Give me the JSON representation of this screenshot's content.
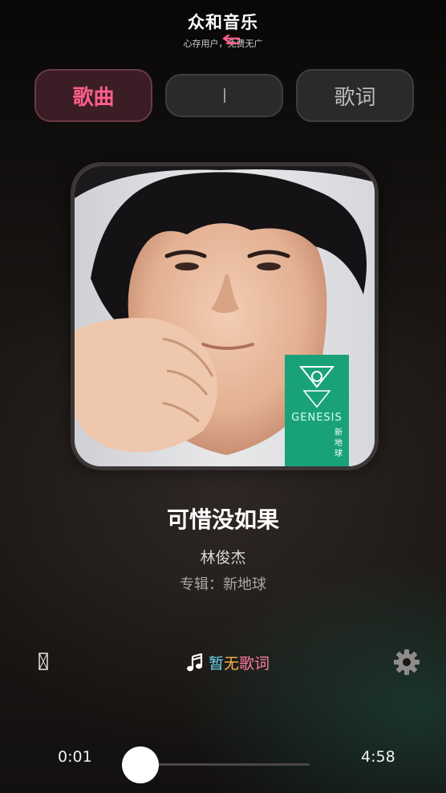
{
  "app": {
    "title": "众和音乐",
    "subtitle": "心存用户，免费无广"
  },
  "tabs": {
    "song_label": "歌曲",
    "middle_label": "",
    "lyrics_label": "歌词",
    "active": "歌曲"
  },
  "song": {
    "title": "可惜没如果",
    "artist": "林俊杰",
    "album_line": "专辑：新地球",
    "album_cover": {
      "brand_text": "GENESIS",
      "title_vertical": "新地球",
      "accent_color": "#1aa57b"
    }
  },
  "lyrics_status": {
    "icon": "music-note-icon",
    "part1": "暂",
    "part2": "无",
    "part3": "歌词",
    "colors": [
      "#6fd7f0",
      "#ffb24d",
      "#ff7aa2"
    ]
  },
  "playback": {
    "current_time": "0:01",
    "total_time": "4:58",
    "progress_fraction": 0.003
  },
  "icons": {
    "settings": "gear-icon",
    "left": "missing-glyph-icon"
  },
  "colors": {
    "accent_pink": "#ff5f8a",
    "active_tab_bg": "#3a1d25",
    "inactive_tab_bg": "#2b2a2a"
  }
}
